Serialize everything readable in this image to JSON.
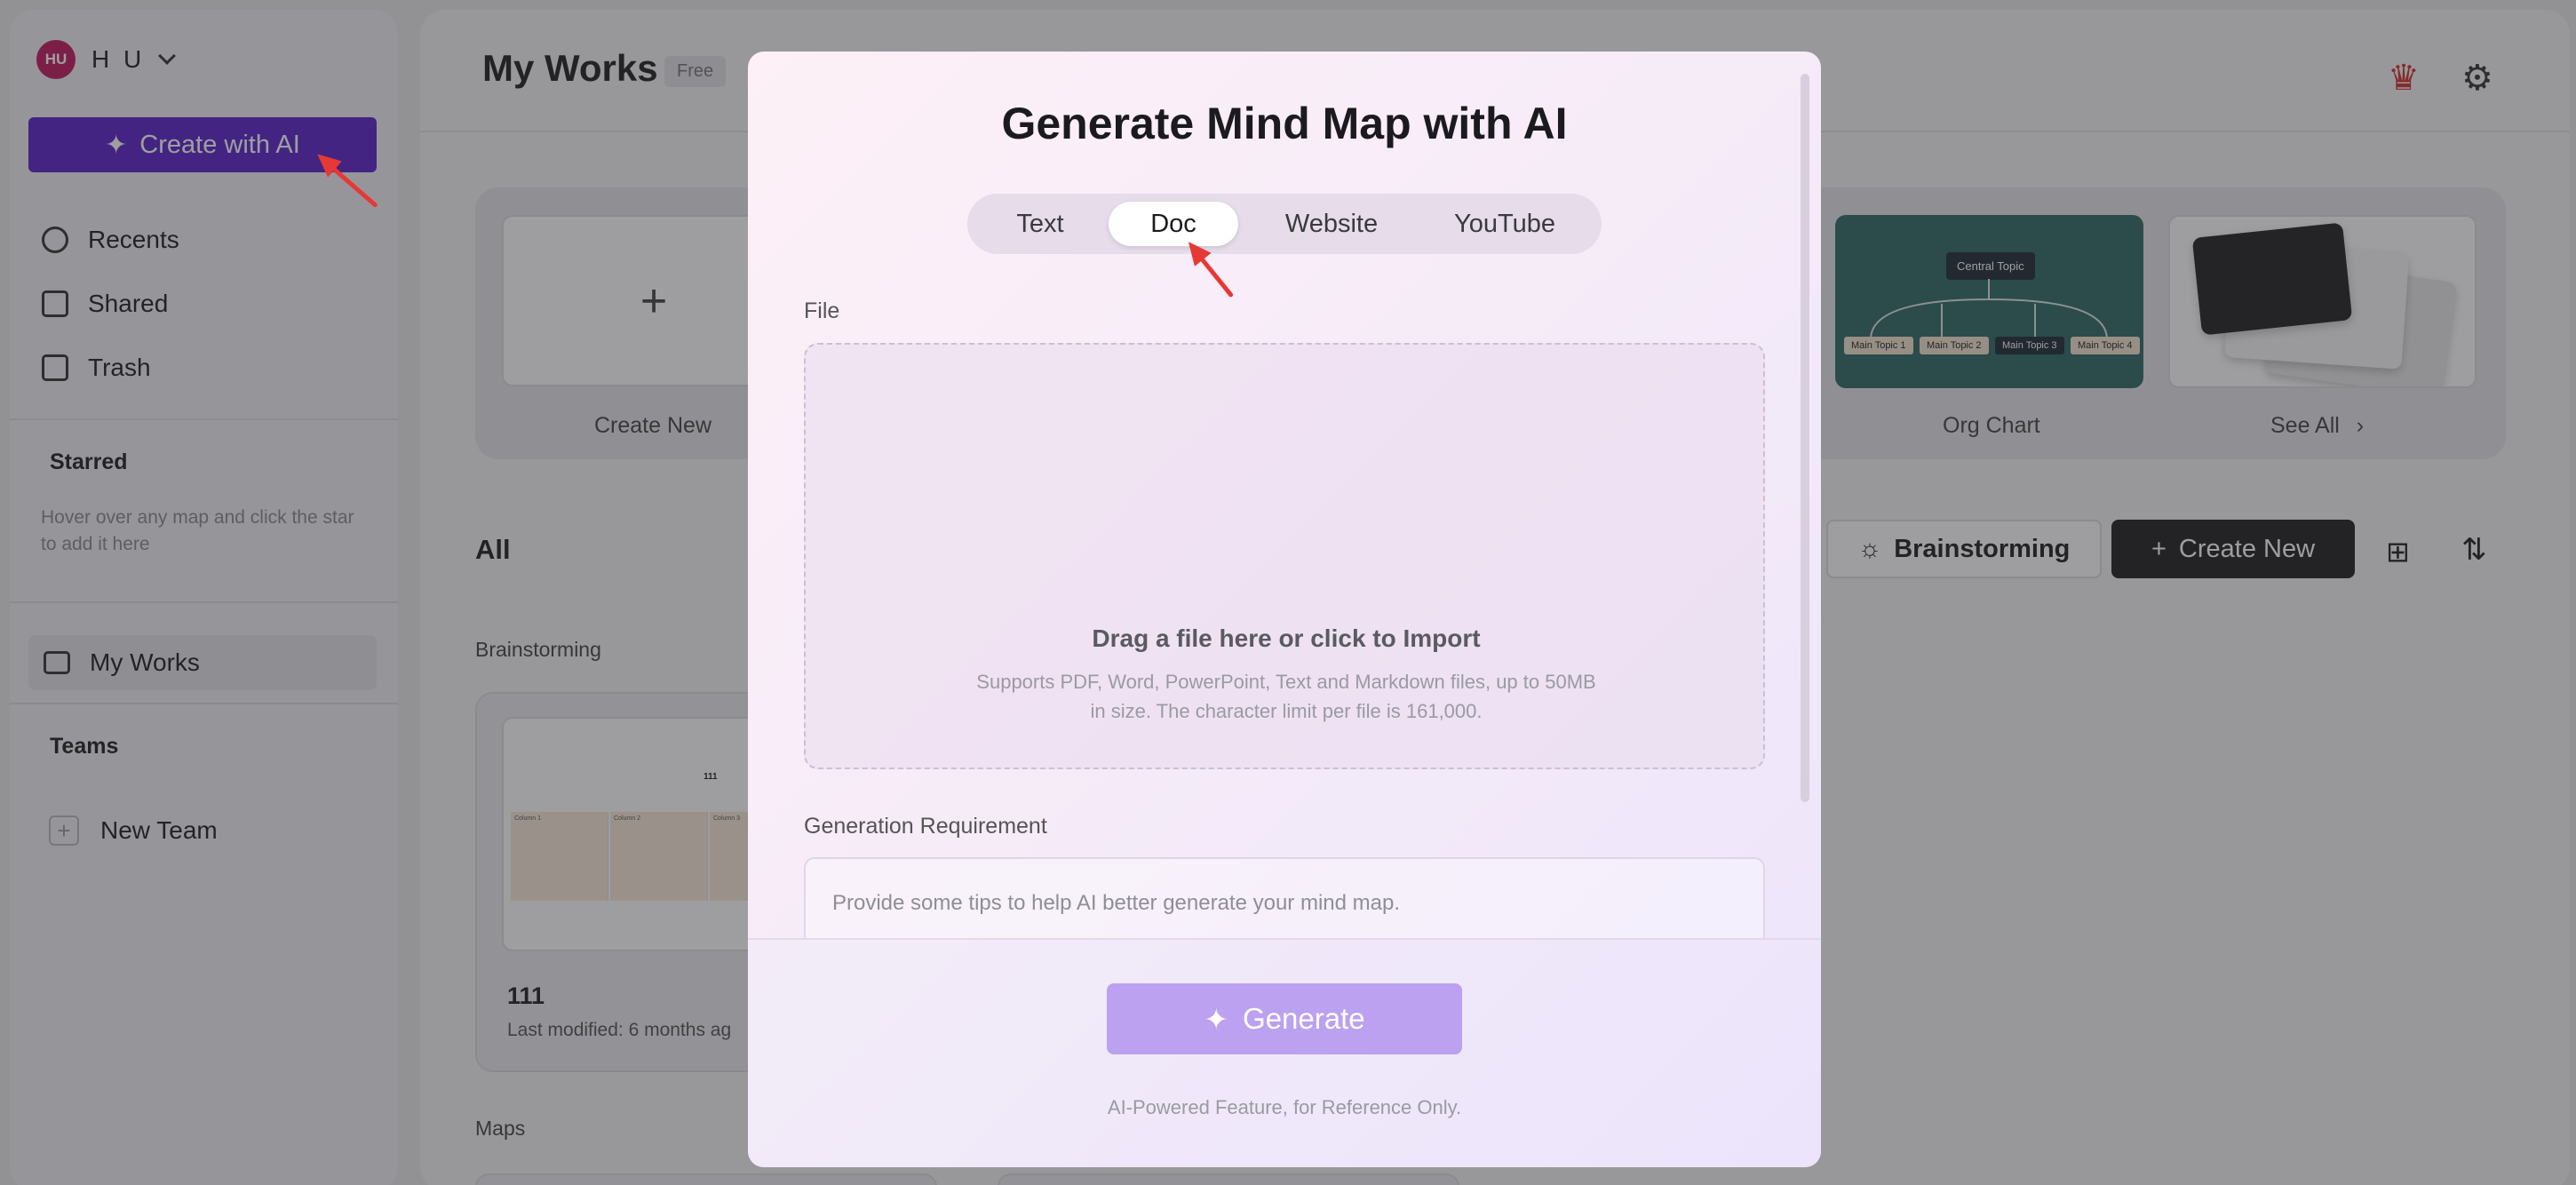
{
  "sidebar": {
    "avatar_initials": "HU",
    "user_name": "H U",
    "create_ai_label": "Create with AI",
    "nav": {
      "recents": "Recents",
      "shared": "Shared",
      "trash": "Trash"
    },
    "starred_title": "Starred",
    "starred_hint": "Hover over any map and click the star to add it here",
    "my_works": "My Works",
    "teams_title": "Teams",
    "new_team": "New Team"
  },
  "main": {
    "title": "My Works",
    "plan_badge": "Free",
    "templates": {
      "create_new": "Create New",
      "org_chart": "Org Chart",
      "see_all": "See All",
      "org_center": "Central Topic",
      "org_topics": [
        "Main Topic 1",
        "Main Topic 2",
        "Main Topic 3",
        "Main Topic 4"
      ]
    },
    "all_label": "All",
    "brainstorming_button": "Brainstorming",
    "create_new_button": "Create New",
    "group_brainstorming": "Brainstorming",
    "group_maps": "Maps",
    "file": {
      "title": "111",
      "modified": "Last modified: 6 months ag",
      "thumb_heading": "111",
      "thumb_cols": [
        "Column 1",
        "Column 2",
        "Column 3"
      ]
    }
  },
  "modal": {
    "title": "Generate Mind Map with AI",
    "tabs": [
      "Text",
      "Doc",
      "Website",
      "YouTube"
    ],
    "active_tab": "Doc",
    "file_label": "File",
    "drop_title": "Drag a file here or click to Import",
    "drop_sub": "Supports PDF, Word, PowerPoint, Text and Markdown files, up to 50MB in size. The character limit per file is 161,000.",
    "requirement_label": "Generation Requirement",
    "requirement_placeholder": "Provide some tips to help AI better generate your mind map.",
    "generate_label": "Generate",
    "note": "AI-Powered Feature, for Reference Only."
  },
  "colors": {
    "brand_purple": "#5a22c9",
    "generate_disabled": "#bba1f0",
    "annotation_arrow": "#e53935"
  },
  "icons": [
    "chevron-down-icon",
    "sparkle-icon",
    "clock-icon",
    "shared-icon",
    "trash-icon",
    "inbox-icon",
    "plus-icon",
    "crown-icon",
    "gear-icon",
    "lightbulb-icon",
    "grid-icon",
    "sort-icon",
    "chevron-right-icon"
  ]
}
